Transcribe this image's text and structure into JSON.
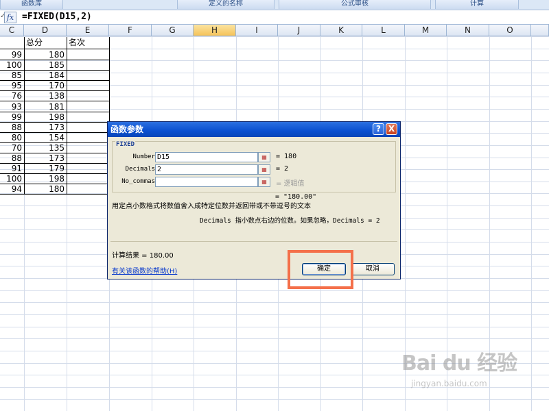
{
  "ribbon": {
    "groups": [
      "函数库",
      "定义的名称",
      "公式审核",
      "计算"
    ]
  },
  "formula_bar": {
    "fx_icon": "fx",
    "formula": "=FIXED(D15,2)"
  },
  "grid": {
    "column_headers": [
      "C",
      "D",
      "E",
      "F",
      "G",
      "H",
      "I",
      "J",
      "K",
      "L",
      "M",
      "N",
      "O"
    ],
    "selected_column": "H",
    "header_row": {
      "D": "总分",
      "E": "名次"
    },
    "rows": [
      {
        "C": "99",
        "D": "180"
      },
      {
        "C": "100",
        "D": "185"
      },
      {
        "C": "85",
        "D": "184"
      },
      {
        "C": "95",
        "D": "170"
      },
      {
        "C": "76",
        "D": "138"
      },
      {
        "C": "93",
        "D": "181"
      },
      {
        "C": "99",
        "D": "198"
      },
      {
        "C": "88",
        "D": "173"
      },
      {
        "C": "80",
        "D": "154"
      },
      {
        "C": "70",
        "D": "135"
      },
      {
        "C": "88",
        "D": "173"
      },
      {
        "C": "91",
        "D": "179"
      },
      {
        "C": "100",
        "D": "198"
      },
      {
        "C": "94",
        "D": "180"
      }
    ]
  },
  "dialog": {
    "title": "函数参数",
    "help_button": "?",
    "close_button": "X",
    "function_name": "FIXED",
    "args": [
      {
        "label": "Number",
        "value": "D15",
        "result": "= 180"
      },
      {
        "label": "Decimals",
        "value": "2",
        "result": "= 2"
      },
      {
        "label": "No_commas",
        "value": "",
        "result": "= 逻辑值"
      }
    ],
    "overall_result": "= \"180.00\"",
    "description": "用定点小数格式将数值舍入成特定位数并返回带或不带逗号的文本",
    "arg_help": "Decimals  指小数点右边的位数。如果忽略，Decimals = 2",
    "calc_result": "计算结果 =  180.00",
    "help_link": "有关该函数的帮助(H)",
    "ok_button": "确定",
    "cancel_button": "取消"
  },
  "watermark": {
    "brand": "Bai du 经验",
    "url": "jingyan.baidu.com"
  },
  "colors": {
    "highlight": "#f4704a",
    "titlebar": "#0a4fd0",
    "dialog_bg": "#ece9d8"
  }
}
